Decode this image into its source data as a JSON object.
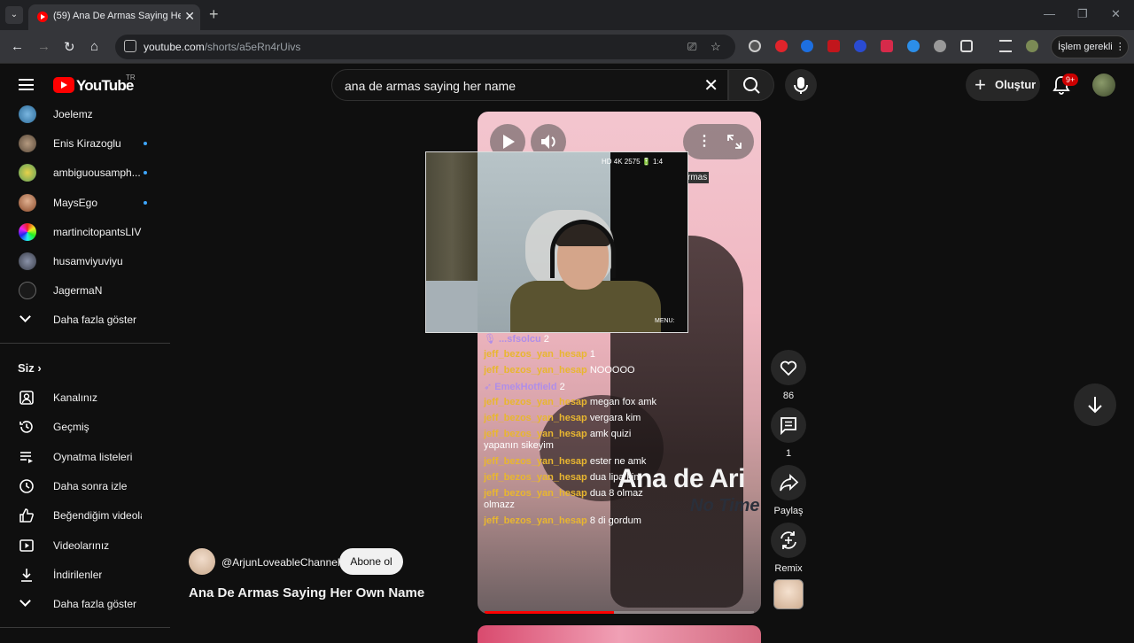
{
  "browser": {
    "tab_title": "(59) Ana De Armas Saying Her Own Name",
    "url_host": "youtube.com",
    "url_path": "/shorts/a5eRn4rUivs",
    "action_label": "İşlem gerekli"
  },
  "header": {
    "logo_text": "YouTube",
    "logo_region": "TR",
    "search_value": "ana de armas saying her name",
    "create_label": "Oluştur",
    "notification_count": "9+"
  },
  "sidebar": {
    "subscriptions": [
      {
        "label": "Joelemz",
        "dot": false
      },
      {
        "label": "Enis Kirazoglu",
        "dot": true
      },
      {
        "label": "ambiguousamph...",
        "dot": true
      },
      {
        "label": "MaysEgo",
        "dot": true
      },
      {
        "label": "martincitopantsLIVE",
        "dot": false
      },
      {
        "label": "husamviyuviyu",
        "dot": false
      },
      {
        "label": "JagermaN",
        "dot": false
      }
    ],
    "show_more_1": "Daha fazla göster",
    "section_title": "Siz",
    "you_items": [
      {
        "label": "Kanalınız",
        "icon": "channel-icon"
      },
      {
        "label": "Geçmiş",
        "icon": "history-icon"
      },
      {
        "label": "Oynatma listeleri",
        "icon": "playlists-icon"
      },
      {
        "label": "Daha sonra izle",
        "icon": "watch-later-icon"
      },
      {
        "label": "Beğendiğim videolar",
        "icon": "liked-icon"
      },
      {
        "label": "Videolarınız",
        "icon": "your-videos-icon"
      },
      {
        "label": "İndirilenler",
        "icon": "downloads-icon"
      }
    ],
    "show_more_2": "Daha fazla göster"
  },
  "short": {
    "chip_text": "rmas",
    "overlay_big": "Ana de Ari",
    "overlay_sub": "No Time",
    "progress": 0.48,
    "cam_hud": "HD 4K 2575 🔋 1:4",
    "cam_menu": "MENU:",
    "chat": [
      {
        "user": "...sfsolcu",
        "msg": "2",
        "badge": "🎙",
        "alt": true
      },
      {
        "user": "jeff_bezos_yan_hesap",
        "msg": "1"
      },
      {
        "user": "jeff_bezos_yan_hesap",
        "msg": "NOOOOO"
      },
      {
        "user": "EmekHotfield",
        "msg": "2",
        "badge": "➶",
        "alt": true
      },
      {
        "user": "jeff_bezos_yan_hesap",
        "msg": "megan fox amk"
      },
      {
        "user": "jeff_bezos_yan_hesap",
        "msg": "vergara kim"
      },
      {
        "user": "jeff_bezos_yan_hesap",
        "msg": "amk quizi"
      },
      {
        "user": "",
        "msg": "yapanın sikeyim"
      },
      {
        "user": "jeff_bezos_yan_hesap",
        "msg": "ester ne amk"
      },
      {
        "user": "jeff_bezos_yan_hesap",
        "msg": "dua lipa kim"
      },
      {
        "user": "jeff_bezos_yan_hesap",
        "msg": "dua 8 olmaz"
      },
      {
        "user": "",
        "msg": "olmazz"
      },
      {
        "user": "jeff_bezos_yan_hesap",
        "msg": "8 di gordum"
      }
    ]
  },
  "actions": {
    "like_count": "86",
    "comment_count": "1",
    "share_label": "Paylaş",
    "remix_label": "Remix"
  },
  "video": {
    "channel": "@ArjunLoveableChannel",
    "subscribe_label": "Abone ol",
    "title": "Ana De Armas Saying Her Own Name"
  }
}
